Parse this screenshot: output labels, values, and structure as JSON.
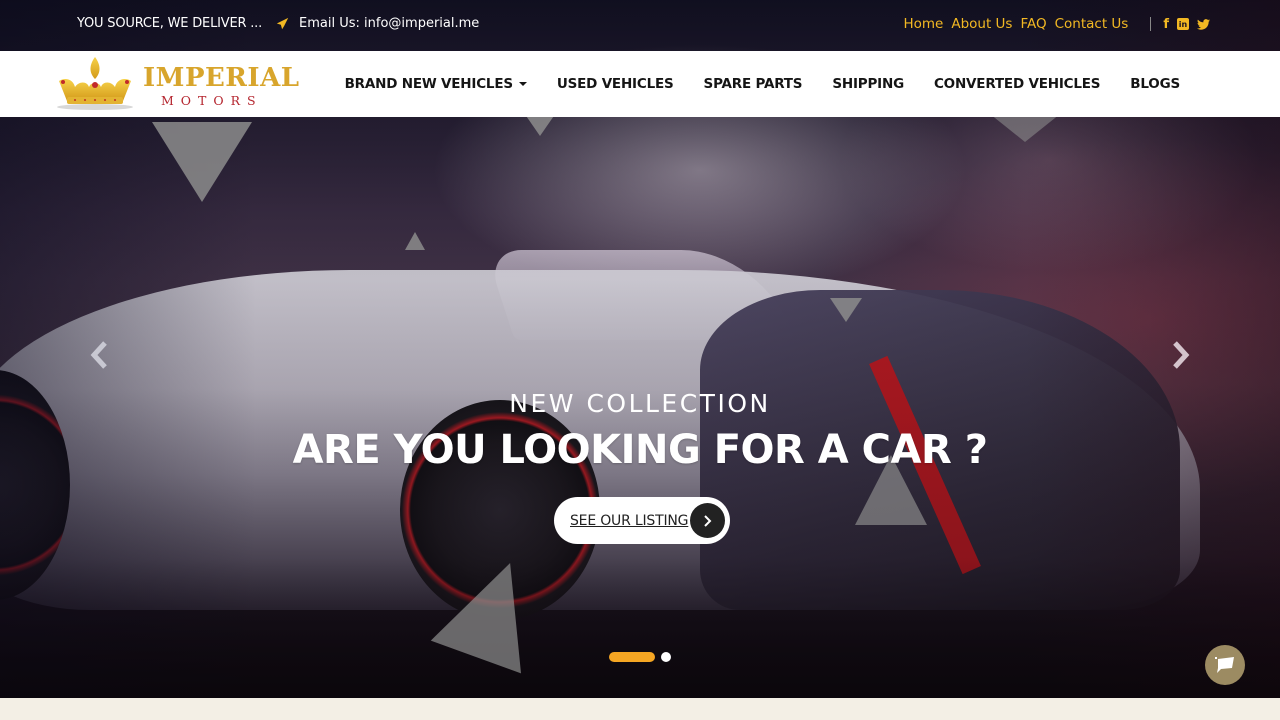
{
  "topbar": {
    "tagline": "YOU SOURCE, WE DELIVER ...",
    "email_label": "Email Us: info@imperial.me",
    "icons": {
      "email": "paper-plane-icon",
      "facebook": "facebook-icon",
      "linkedin": "linkedin-icon",
      "twitter": "twitter-icon"
    },
    "links": [
      {
        "label": "Home"
      },
      {
        "label": "About Us"
      },
      {
        "label": "FAQ"
      },
      {
        "label": "Contact Us"
      }
    ],
    "accent_color": "#f2b823"
  },
  "logo": {
    "word1": "IMPERIAL",
    "word2": "MOTORS",
    "icon": "crown-icon"
  },
  "nav": {
    "items": [
      {
        "label": "BRAND NEW VEHICLES",
        "has_dropdown": true
      },
      {
        "label": "USED VEHICLES"
      },
      {
        "label": "SPARE PARTS"
      },
      {
        "label": "SHIPPING"
      },
      {
        "label": "CONVERTED VEHICLES"
      },
      {
        "label": "BLOGS"
      }
    ]
  },
  "hero": {
    "subtitle": "NEW COLLECTION",
    "title": "ARE YOU LOOKING FOR A CAR ?",
    "cta_label": "SEE OUR LISTING",
    "prev_icon": "chevron-left-icon",
    "next_icon": "chevron-right-icon",
    "slides_total": 2,
    "active_slide": 1,
    "active_dot_color": "#f5a623"
  },
  "chat": {
    "icon": "chat-bubble-icon",
    "color": "#9c8b62"
  }
}
